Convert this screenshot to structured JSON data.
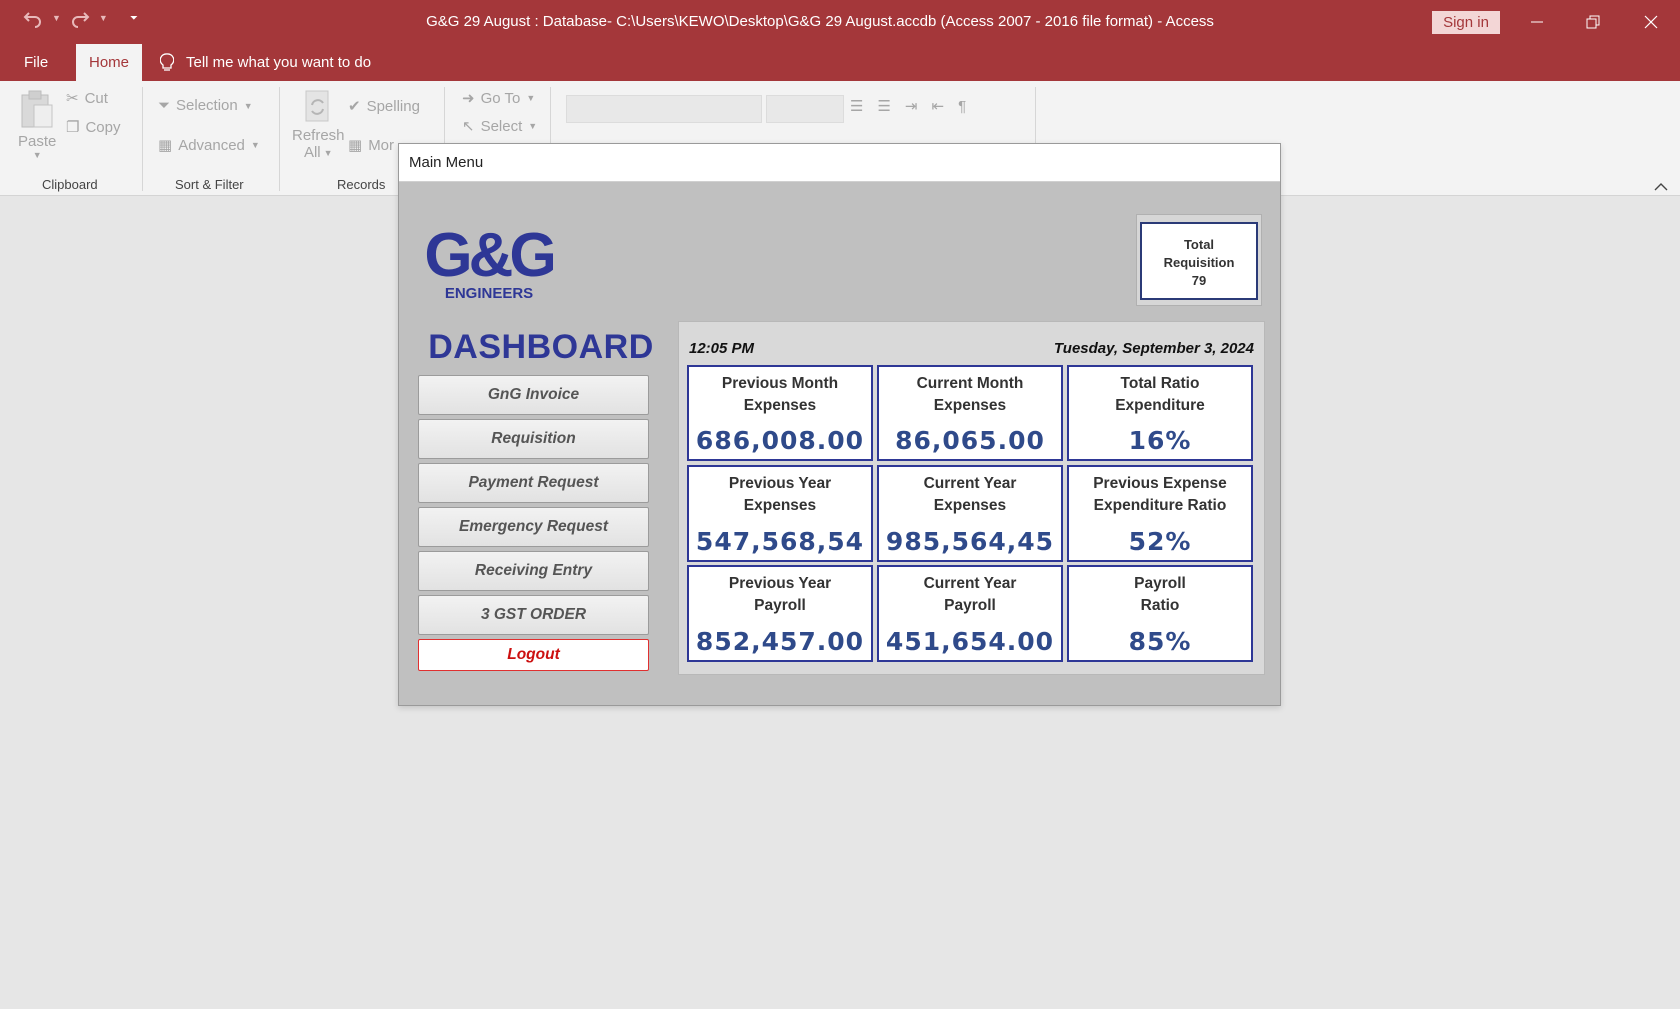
{
  "window": {
    "title": "G&G 29 August : Database- C:\\Users\\KEWO\\Desktop\\G&G 29 August.accdb (Access 2007 - 2016 file format)  -  Access",
    "sign_in": "Sign in"
  },
  "tabs": {
    "file": "File",
    "home": "Home",
    "tell_me": "Tell me what you want to do"
  },
  "ribbon": {
    "paste": "Paste",
    "cut": "Cut",
    "copy": "Copy",
    "selection": "Selection",
    "advanced": "Advanced",
    "refresh": "Refresh",
    "all": "All",
    "spelling": "Spelling",
    "more": "Mor",
    "go_to": "Go To",
    "select": "Select",
    "groups": {
      "clipboard": "Clipboard",
      "sort_filter": "Sort & Filter",
      "records": "Records"
    }
  },
  "form": {
    "title": "Main Menu",
    "logo_text": "G&G",
    "logo_sub": "ENGINEERS",
    "dashboard": "DASHBOARD",
    "total_requisition": {
      "line1": "Total",
      "line2": "Requisition",
      "value": "79"
    },
    "time": "12:05 PM",
    "date": "Tuesday, September 3, 2024",
    "buttons": [
      "GnG Invoice",
      "Requisition",
      "Payment Request",
      "Emergency Request",
      "Receiving Entry",
      "3 GST ORDER"
    ],
    "logout": "Logout",
    "cards": [
      {
        "l1": "Previous Month",
        "l2": "Expenses",
        "value": "686,008.00"
      },
      {
        "l1": "Current Month",
        "l2": "Expenses",
        "value": "86,065.00"
      },
      {
        "l1": "Total Ratio",
        "l2": "Expenditure",
        "value": "16%"
      },
      {
        "l1": "Previous Year",
        "l2": "Expenses",
        "value": "547,568,54"
      },
      {
        "l1": "Current Year",
        "l2": "Expenses",
        "value": "985,564,45"
      },
      {
        "l1": "Previous Expense",
        "l2": "Expenditure Ratio",
        "value": "52%"
      },
      {
        "l1": "Previous Year",
        "l2": "Payroll",
        "value": "852,457.00"
      },
      {
        "l1": "Current Year",
        "l2": "Payroll",
        "value": "451,654.00"
      },
      {
        "l1": "Payroll",
        "l2": "Ratio",
        "value": "85%"
      }
    ]
  }
}
